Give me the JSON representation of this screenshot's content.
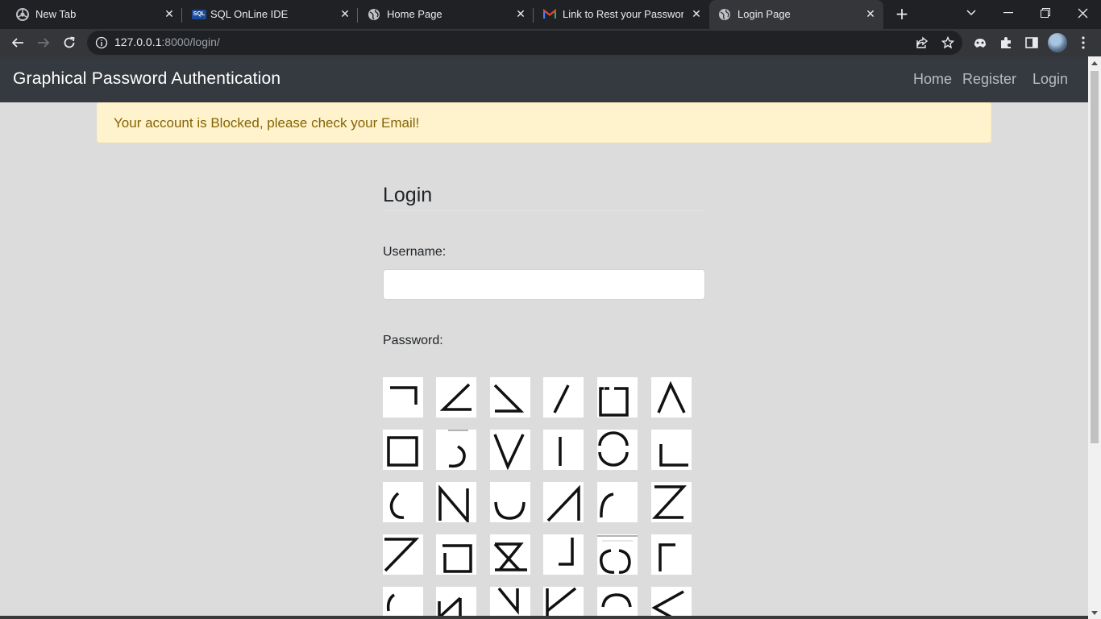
{
  "browser": {
    "tabs": [
      {
        "title": "New Tab",
        "icon": "chrome-icon",
        "active": false
      },
      {
        "title": "SQL OnLine IDE",
        "icon": "sql-icon",
        "active": false
      },
      {
        "title": "Home Page",
        "icon": "globe-icon",
        "active": false
      },
      {
        "title": "Link to Rest your Password -",
        "icon": "gmail-icon",
        "active": false
      },
      {
        "title": "Login Page",
        "icon": "globe-icon",
        "active": true
      }
    ],
    "sql_badge": "SQL",
    "url_host": "127.0.0.1",
    "url_rest": ":8000/login/",
    "accent": "#35363a"
  },
  "navbar": {
    "brand": "Graphical Password Authentication",
    "links": [
      "Home",
      "Register",
      "Login"
    ]
  },
  "alert": {
    "message": "Your account is Blocked, please check your Email!",
    "bg": "#fff3cd",
    "fg": "#856404"
  },
  "form": {
    "heading": "Login",
    "username_label": "Username:",
    "username_value": "",
    "password_label": "Password:"
  },
  "password_grid": {
    "columns": 6,
    "tiles": [
      "corner-top-right",
      "angle-symbol",
      "angle-down-right",
      "slash",
      "open-box-top",
      "caret-up",
      "square",
      "hook-j",
      "letter-v",
      "vertical-bar",
      "circle-split",
      "corner-bottom-left",
      "arc-left",
      "letter-n",
      "arc-bottom",
      "slash-vertical-right",
      "arc-top-left",
      "letter-z",
      "seven",
      "open-box-right",
      "z-boxed",
      "corner-bottom-right",
      "circle-broken",
      "corner-top-left",
      "arc-left-partial",
      "letter-n-reverse",
      "backslash-bar",
      "bar-slash",
      "arc-top",
      "less-than"
    ]
  }
}
